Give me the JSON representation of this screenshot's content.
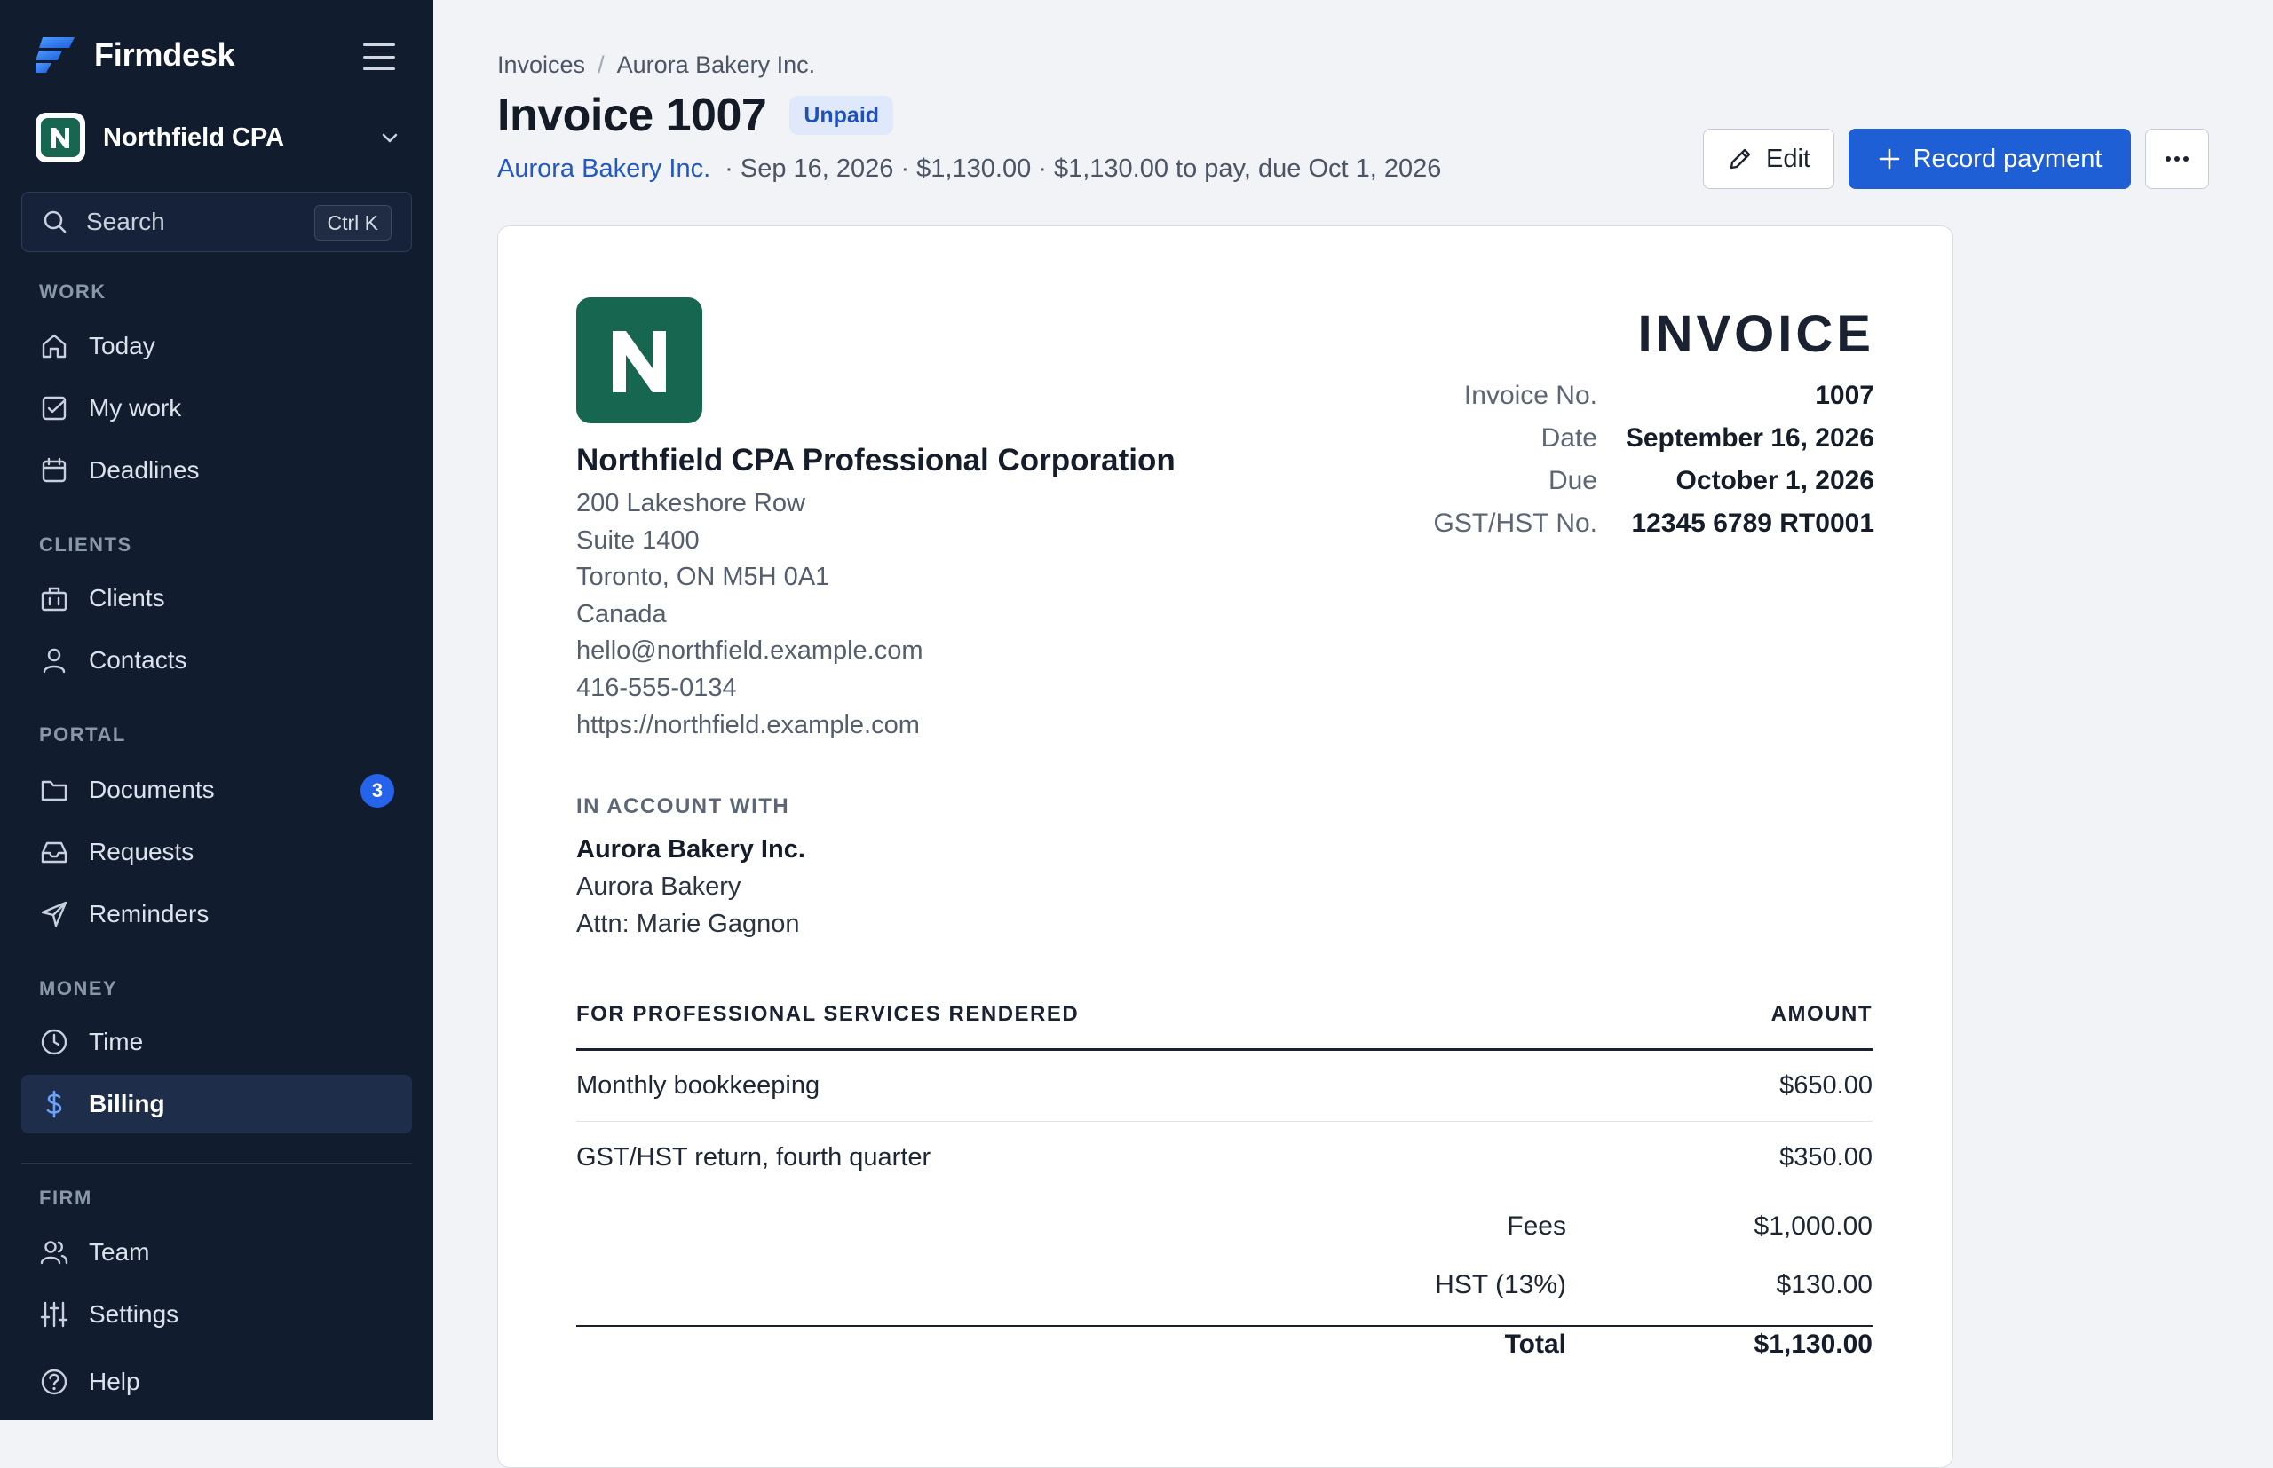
{
  "app": {
    "name": "Firmdesk"
  },
  "org": {
    "name": "Northfield CPA"
  },
  "search": {
    "label": "Search",
    "shortcut": "Ctrl K"
  },
  "nav": {
    "sections": {
      "work": "WORK",
      "clients": "CLIENTS",
      "portal": "PORTAL",
      "money": "MONEY",
      "firm": "FIRM"
    },
    "items": {
      "today": "Today",
      "my_work": "My work",
      "deadlines": "Deadlines",
      "clients": "Clients",
      "contacts": "Contacts",
      "documents": "Documents",
      "documents_badge": "3",
      "requests": "Requests",
      "reminders": "Reminders",
      "time": "Time",
      "billing": "Billing",
      "team": "Team",
      "settings": "Settings",
      "help": "Help"
    },
    "active": "billing"
  },
  "header": {
    "breadcrumb": [
      "Invoices",
      "Aurora Bakery Inc."
    ],
    "breadcrumb_sep": "/",
    "title": "Invoice 1007",
    "status": "Unpaid",
    "client_link": "Aurora Bakery Inc.",
    "meta": "· Sep 16, 2026 · $1,130.00 · $1,130.00 to pay, due Oct 1, 2026"
  },
  "actions": {
    "edit": "Edit",
    "record_payment": "Record payment"
  },
  "invoice": {
    "logo_letter": "N",
    "firm": {
      "name": "Northfield CPA Professional Corporation",
      "address_line1": "200 Lakeshore Row",
      "address_line2": "Suite 1400",
      "city_line": "Toronto, ON M5H 0A1",
      "country": "Canada",
      "email": "hello@northfield.example.com",
      "phone": "416-555-0134",
      "website": "https://northfield.example.com"
    },
    "heading": "INVOICE",
    "meta": [
      {
        "label": "Invoice No.",
        "value": "1007"
      },
      {
        "label": "Date",
        "value": "September 16, 2026"
      },
      {
        "label": "Due",
        "value": "October 1, 2026"
      },
      {
        "label": "GST/HST No.",
        "value": "12345 6789 RT0001"
      }
    ],
    "account": {
      "label": "IN ACCOUNT WITH",
      "name": "Aurora Bakery Inc.",
      "line1": "Aurora Bakery",
      "line2": "Attn: Marie Gagnon"
    },
    "services_header": "FOR PROFESSIONAL SERVICES RENDERED",
    "amount_header": "AMOUNT",
    "line_items": [
      {
        "description": "Monthly bookkeeping",
        "amount": "$650.00"
      },
      {
        "description": "GST/HST return, fourth quarter",
        "amount": "$350.00"
      }
    ],
    "totals": {
      "fees_label": "Fees",
      "fees": "$1,000.00",
      "tax_label": "HST (13%)",
      "tax": "$130.00",
      "total_label": "Total",
      "total": "$1,130.00"
    }
  },
  "colors": {
    "sidebar_bg": "#111c2e",
    "accent": "#1f5fd6",
    "brand_green": "#166650",
    "badge_blue": "#2563eb"
  }
}
